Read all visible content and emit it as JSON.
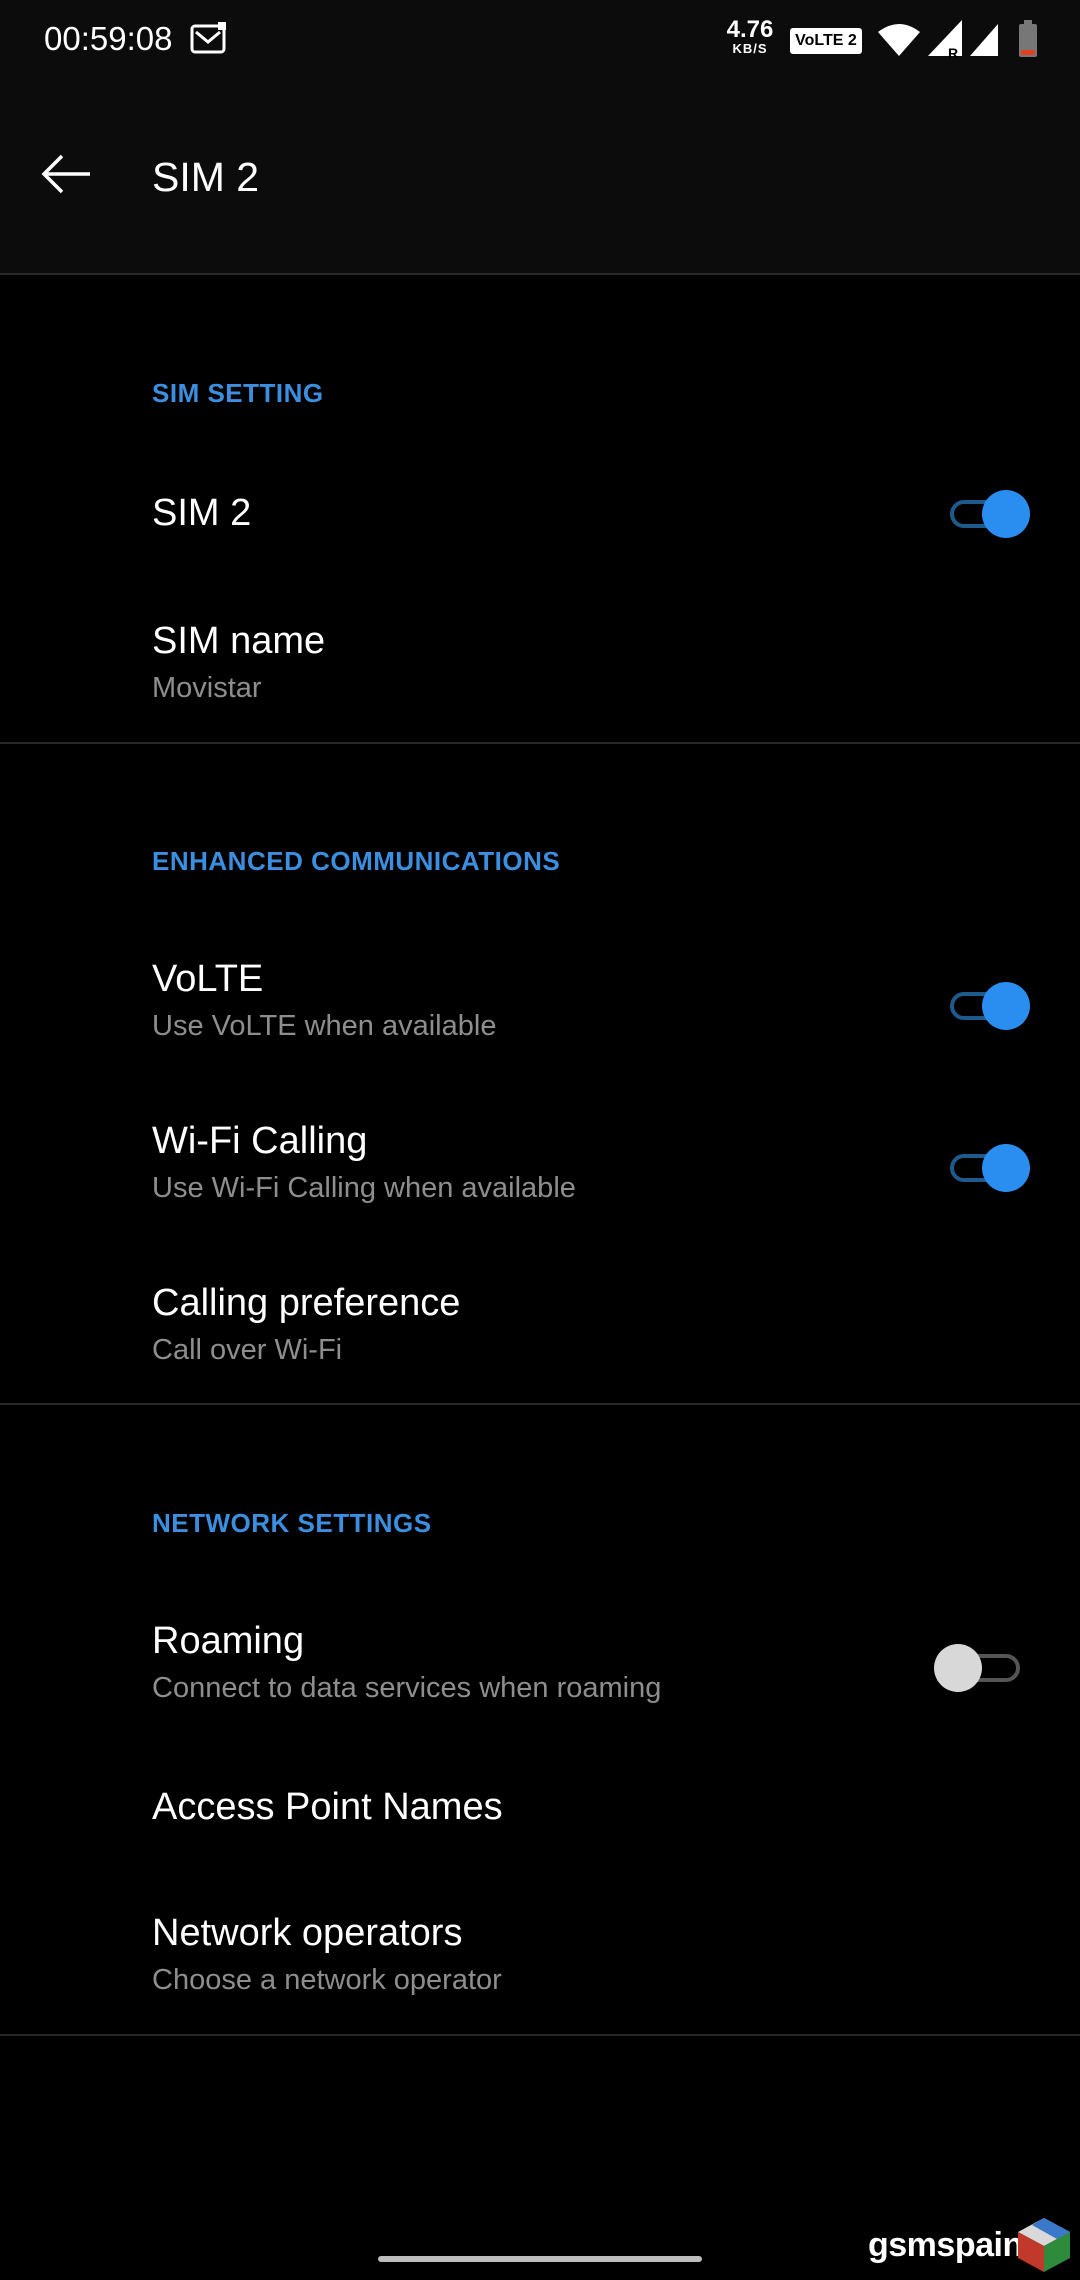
{
  "status_bar": {
    "time": "00:59:08",
    "speed_value": "4.76",
    "speed_unit": "KB/S",
    "volte_badge": "VoLTE 2"
  },
  "app_bar": {
    "title": "SIM 2"
  },
  "sections": {
    "sim_setting": {
      "header": "SIM SETTING",
      "sim_toggle": {
        "title": "SIM 2",
        "on": true
      },
      "sim_name": {
        "title": "SIM name",
        "subtitle": "Movistar"
      }
    },
    "enhanced_communications": {
      "header": "ENHANCED COMMUNICATIONS",
      "volte": {
        "title": "VoLTE",
        "subtitle": "Use VoLTE when available",
        "on": true
      },
      "wifi_calling": {
        "title": "Wi-Fi Calling",
        "subtitle": "Use Wi-Fi Calling when available",
        "on": true
      },
      "calling_preference": {
        "title": "Calling preference",
        "subtitle": "Call over Wi-Fi"
      }
    },
    "network_settings": {
      "header": "NETWORK SETTINGS",
      "roaming": {
        "title": "Roaming",
        "subtitle": "Connect to data services when roaming",
        "on": false
      },
      "apn": {
        "title": "Access Point Names"
      },
      "network_operators": {
        "title": "Network operators",
        "subtitle": "Choose a network operator"
      }
    }
  },
  "watermark": {
    "text": "gsmspain"
  },
  "colors": {
    "accent": "#2a8ef0",
    "section_header": "#3b8fe0",
    "background": "#000000",
    "secondary_text": "#8e8e8e"
  },
  "icons": [
    "mail-icon",
    "wifi-icon",
    "signal-icon",
    "battery-icon",
    "back-arrow-icon"
  ]
}
